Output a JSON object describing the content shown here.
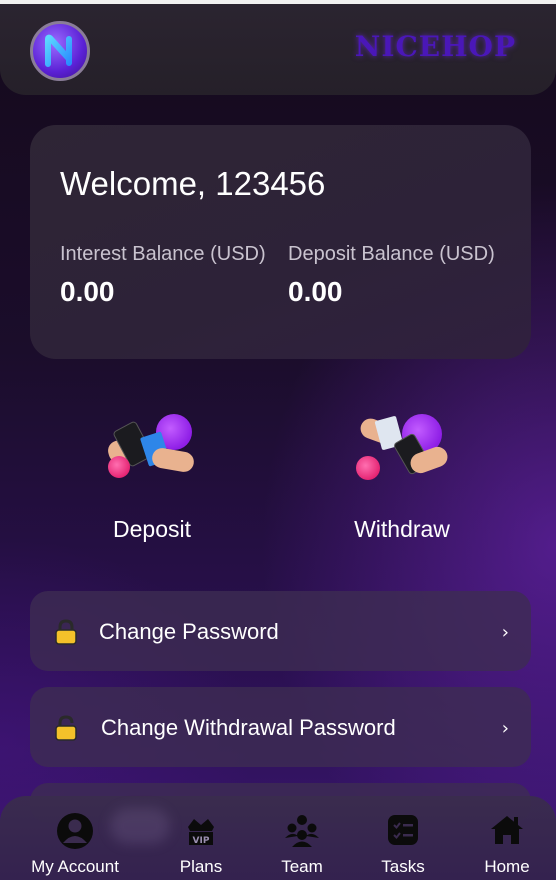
{
  "header": {
    "brand": "NICEHOP",
    "logo_icon": "n-letter-logo-icon"
  },
  "account": {
    "welcome": "Welcome, 123456",
    "balances": [
      {
        "label": "Interest Balance (USD)",
        "value": "0.00"
      },
      {
        "label": "Deposit Balance (USD)",
        "value": "0.00"
      }
    ]
  },
  "actions": [
    {
      "label": "Deposit",
      "icon": "card-payment-icon"
    },
    {
      "label": "Withdraw",
      "icon": "phone-payment-icon"
    }
  ],
  "menu": [
    {
      "label": "Change Password",
      "icon": "lock-icon",
      "chevron": "›"
    },
    {
      "label": "Change Withdrawal Password",
      "icon": "lock-icon",
      "chevron": "›"
    }
  ],
  "nav": [
    {
      "label": "My Account",
      "icon": "user-icon"
    },
    {
      "label": "Plans",
      "icon": "vip-crown-icon"
    },
    {
      "label": "Team",
      "icon": "team-icon"
    },
    {
      "label": "Tasks",
      "icon": "tasks-icon"
    },
    {
      "label": "Home",
      "icon": "home-icon"
    }
  ],
  "colors": {
    "brand": "#4a17b8",
    "accent_purple": "#8e1ee6",
    "accent_pink": "#e3206f",
    "lock_gold": "#f4c12a"
  }
}
